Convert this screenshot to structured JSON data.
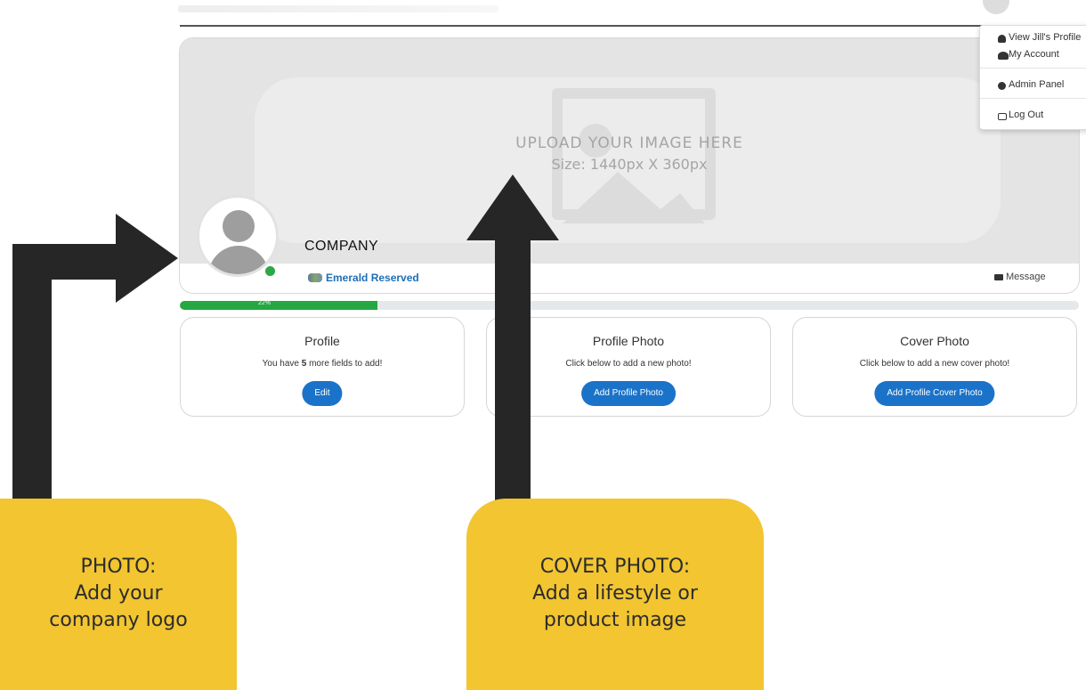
{
  "dropdown": {
    "view_profile": "View Jill's Profile",
    "my_account": "My Account",
    "admin_panel": "Admin Panel",
    "log_out": "Log Out"
  },
  "cover": {
    "upload_title": "UPLOAD YOUR IMAGE HERE",
    "upload_size": "Size: 1440px X 360px"
  },
  "profile": {
    "company_name": "COMPANY",
    "org_link": "Emerald Reserved",
    "message_label": "Message"
  },
  "progress": {
    "percent": 22,
    "label": "22%"
  },
  "cards": [
    {
      "title": "Profile",
      "sub_prefix": "You have ",
      "sub_count": "5",
      "sub_suffix": " more fields to add!",
      "button": "Edit"
    },
    {
      "title": "Profile Photo",
      "sub": "Click below to add a new photo!",
      "button": "Add Profile Photo"
    },
    {
      "title": "Cover Photo",
      "sub": "Click below to add a new cover photo!",
      "button": "Add Profile Cover Photo"
    }
  ],
  "callouts": {
    "photo": [
      "PHOTO:",
      "Add your",
      "company logo"
    ],
    "cover": [
      "COVER PHOTO:",
      "Add a lifestyle or",
      "product image"
    ]
  },
  "colors": {
    "accent_blue": "#1a73c8",
    "progress_green": "#25a742",
    "callout_yellow": "#f2c531",
    "arrow": "#262626"
  }
}
